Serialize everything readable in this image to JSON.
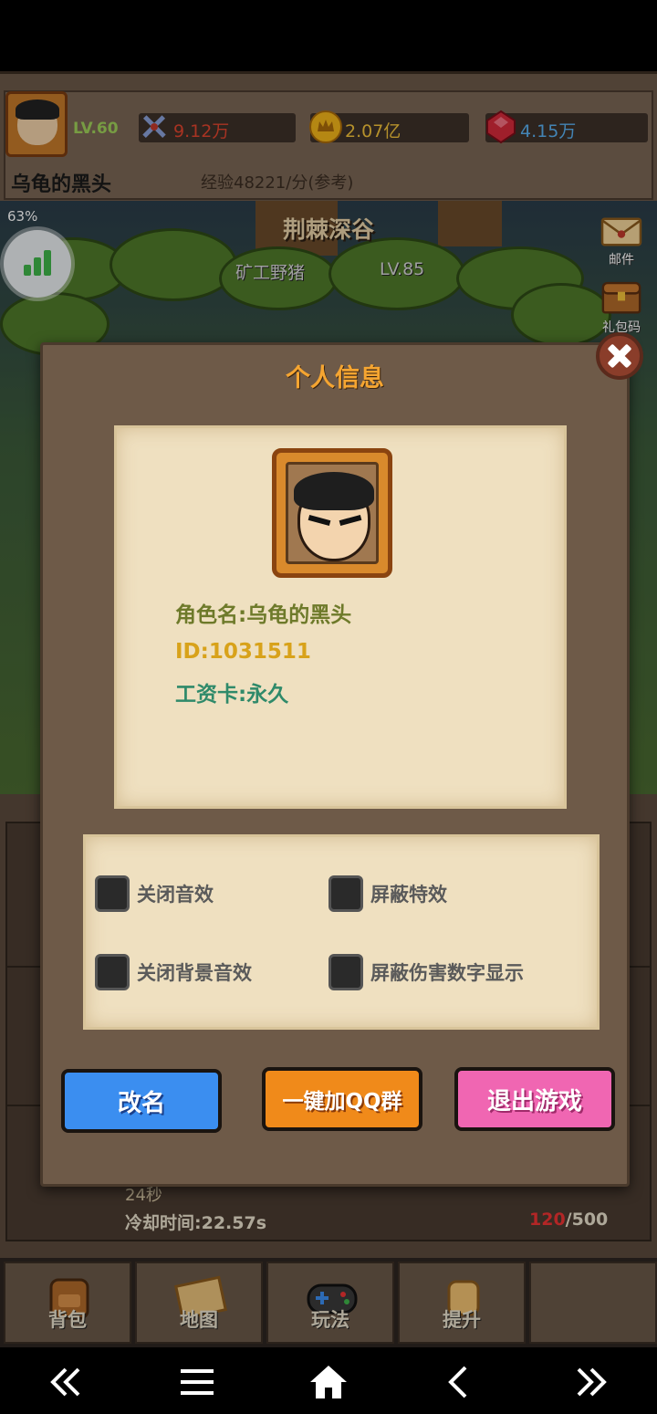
{
  "header": {
    "level": "LV.60",
    "attack": "9.12万",
    "gold": "2.07亿",
    "gems": "4.15万",
    "player_name": "乌龟的黑头",
    "experience": "经验48221/分(参考)"
  },
  "scene": {
    "battery_pct": "63%",
    "location": "荆棘深谷",
    "enemy_name": "矿工野猪",
    "enemy_level": "LV.85",
    "side_mail": "邮件",
    "side_gift": "礼包码",
    "side_rank": "榜"
  },
  "lower": {
    "time_left": "24秒",
    "cooldown": "冷却时间:22.57s",
    "stamina_current": "120",
    "stamina_max": "/500"
  },
  "modal": {
    "title": "个人信息",
    "role_name": "角色名:乌龟的黑头",
    "id": "ID:1031511",
    "wage_card": "工资卡:永久",
    "settings": {
      "mute_sfx": "关闭音效",
      "hide_effects": "屏蔽特效",
      "mute_bgm": "关闭背景音效",
      "hide_damage": "屏蔽伤害数字显示"
    },
    "buttons": {
      "rename": "改名",
      "join_qq": "一键加QQ群",
      "exit": "退出游戏"
    }
  },
  "game_nav": {
    "bag": "背包",
    "map": "地图",
    "play": "玩法",
    "upgrade": "提升"
  },
  "colors": {
    "title_orange": "#f5a531",
    "rename_blue": "#3b8ef0",
    "qq_orange": "#f08a1a",
    "exit_pink": "#f066b2"
  }
}
